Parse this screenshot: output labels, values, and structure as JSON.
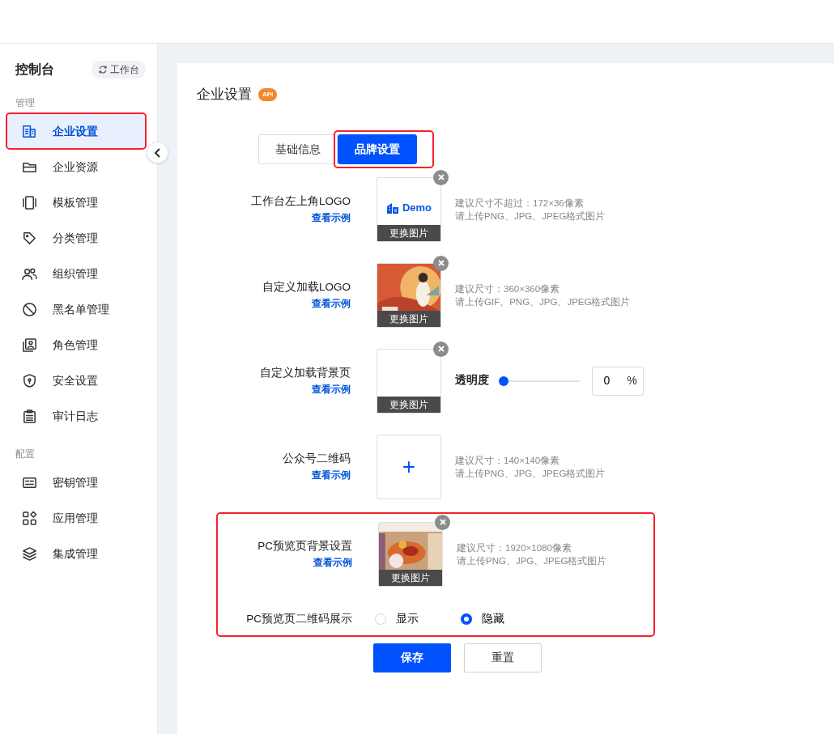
{
  "sidebar": {
    "title": "控制台",
    "switch_button": "工作台",
    "groups": [
      {
        "label": "管理",
        "items": [
          {
            "label": "企业设置",
            "selected": true,
            "highlighted": true
          },
          {
            "label": "企业资源",
            "selected": false,
            "highlighted": false
          },
          {
            "label": "模板管理",
            "selected": false,
            "highlighted": false
          },
          {
            "label": "分类管理",
            "selected": false,
            "highlighted": false
          },
          {
            "label": "组织管理",
            "selected": false,
            "highlighted": false
          },
          {
            "label": "黑名单管理",
            "selected": false,
            "highlighted": false
          },
          {
            "label": "角色管理",
            "selected": false,
            "highlighted": false
          },
          {
            "label": "安全设置",
            "selected": false,
            "highlighted": false
          },
          {
            "label": "审计日志",
            "selected": false,
            "highlighted": false
          }
        ]
      },
      {
        "label": "配置",
        "items": [
          {
            "label": "密钥管理",
            "selected": false,
            "highlighted": false
          },
          {
            "label": "应用管理",
            "selected": false,
            "highlighted": false
          },
          {
            "label": "集成管理",
            "selected": false,
            "highlighted": false
          }
        ]
      }
    ]
  },
  "page": {
    "title": "企业设置",
    "badge": "API",
    "tabs": [
      {
        "label": "基础信息",
        "selected": false,
        "highlighted": false
      },
      {
        "label": "品牌设置",
        "selected": true,
        "highlighted": true
      }
    ],
    "fields": [
      {
        "kind": "logo",
        "label": "工作台左上角LOGO",
        "link": "查看示例",
        "logo_text": "Demo",
        "replace_label": "更换图片",
        "hints": [
          "建议尺寸不超过：172×36像素",
          "请上传PNG、JPG、JPEG格式图片"
        ],
        "highlighted": false
      },
      {
        "kind": "picture",
        "label": "自定义加载LOGO",
        "link": "查看示例",
        "replace_label": "更换图片",
        "hints": [
          "建议尺寸：360×360像素",
          "请上传GIF、PNG、JPG、JPEG格式图片"
        ],
        "highlighted": false
      },
      {
        "kind": "background",
        "label": "自定义加载背景页",
        "link": "查看示例",
        "replace_label": "更换图片",
        "opacity": {
          "label": "透明度",
          "level": 0,
          "value": "0",
          "unit": "%"
        },
        "highlighted": false
      },
      {
        "kind": "add",
        "label": "公众号二维码",
        "link": "查看示例",
        "add_symbol": "+",
        "hints": [
          "建议尺寸：140×140像素",
          "请上传PNG、JPG、JPEG格式图片"
        ],
        "highlighted": false
      },
      {
        "kind": "picture",
        "label": "PC预览页背景设置",
        "link": "查看示例",
        "replace_label": "更换图片",
        "hints": [
          "建议尺寸：1920×1080像素",
          "请上传PNG、JPG、JPEG格式图片"
        ],
        "highlighted": true
      },
      {
        "kind": "radio",
        "label": "PC预览页二维码展示",
        "options": [
          {
            "label": "显示",
            "selected": false
          },
          {
            "label": "隐藏",
            "selected": true
          }
        ],
        "highlighted": true
      }
    ],
    "buttons": [
      {
        "label": "保存",
        "kind": "primary"
      },
      {
        "label": "重置",
        "kind": "secondary"
      }
    ]
  }
}
